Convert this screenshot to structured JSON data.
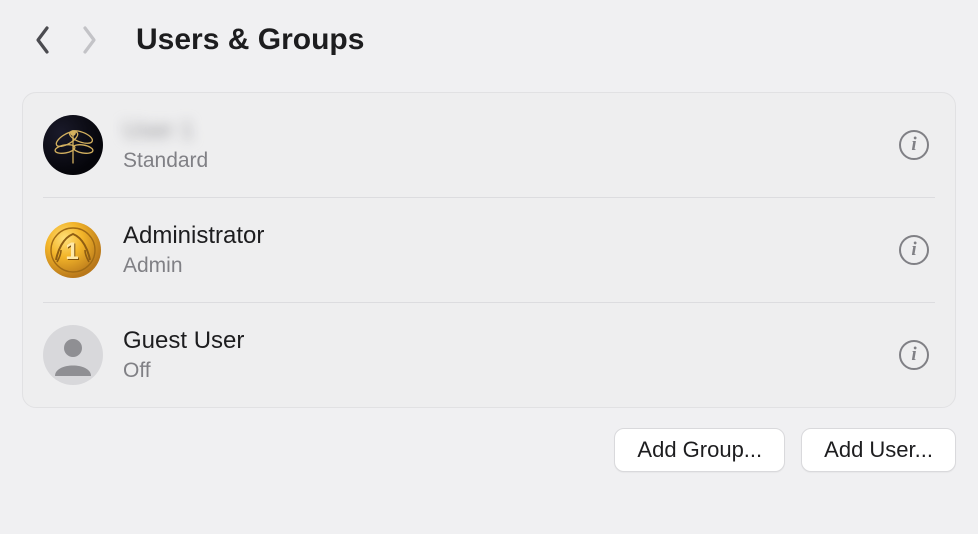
{
  "header": {
    "title": "Users & Groups"
  },
  "users": [
    {
      "name": "User 1",
      "role": "Standard",
      "redacted": true
    },
    {
      "name": "Administrator",
      "role": "Admin"
    },
    {
      "name": "Guest User",
      "role": "Off"
    }
  ],
  "buttons": {
    "add_group": "Add Group...",
    "add_user": "Add User..."
  },
  "icons": {
    "info_glyph": "i"
  }
}
